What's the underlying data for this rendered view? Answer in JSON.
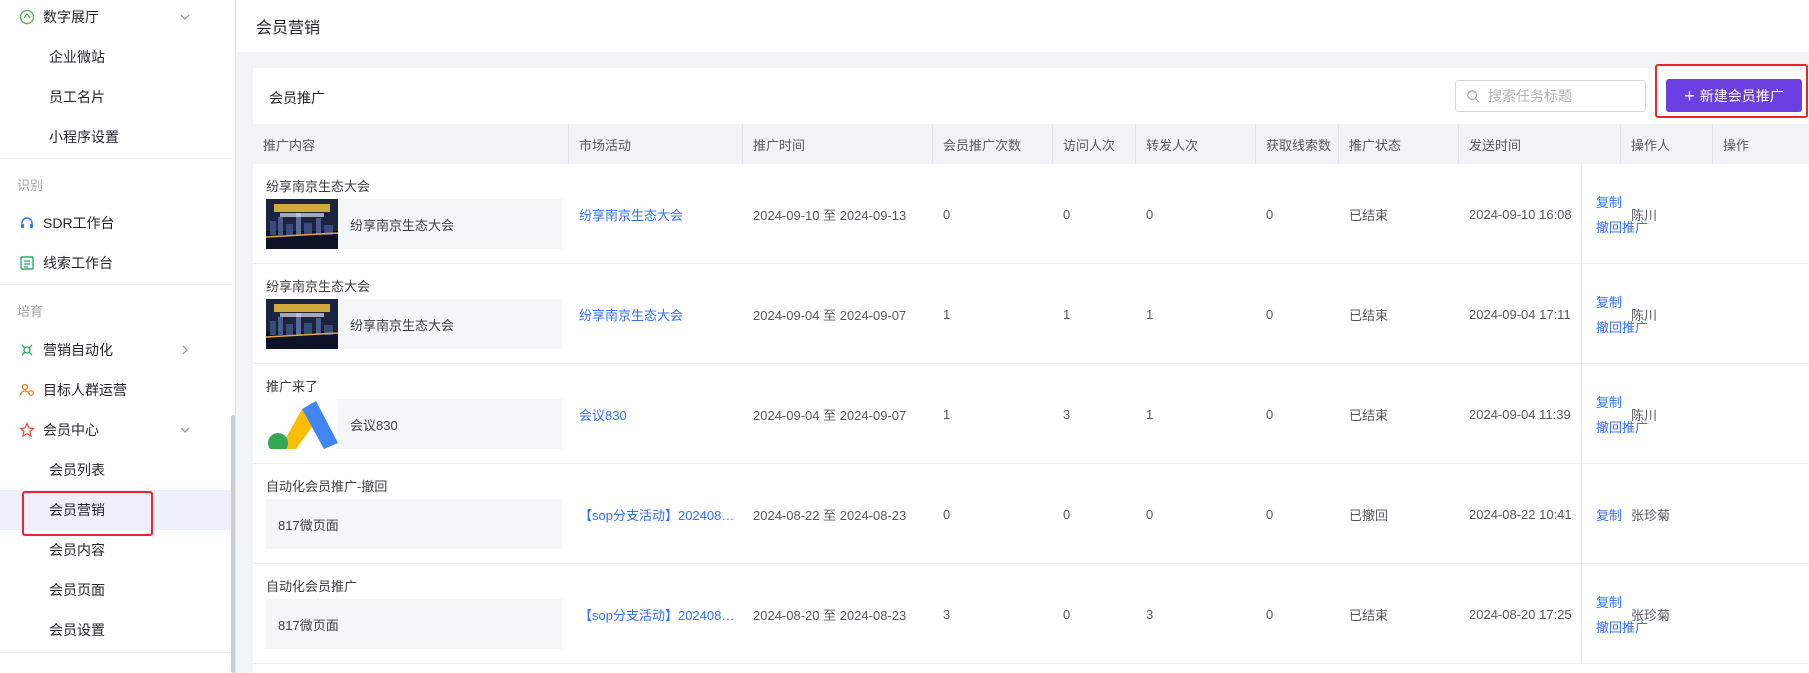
{
  "sidebar": {
    "digital_hall": "数字展厅",
    "items_a": [
      "企业微站",
      "员工名片",
      "小程序设置"
    ],
    "group_identify": "识别",
    "sdr": "SDR工作台",
    "leads": "线索工作台",
    "group_nurture": "培育",
    "marketing_auto": "营销自动化",
    "target_group": "目标人群运营",
    "member_center": "会员中心",
    "member_items": [
      "会员列表",
      "会员营销",
      "会员内容",
      "会员页面",
      "会员设置"
    ],
    "active_item": "会员营销"
  },
  "topbar": {
    "title": "会员营销"
  },
  "card": {
    "title": "会员推广",
    "search_placeholder": "搜索任务标题",
    "new_button": "新建会员推广"
  },
  "table": {
    "headers": [
      "推广内容",
      "市场活动",
      "推广时间",
      "会员推广次数",
      "访问人次",
      "转发人次",
      "获取线索数",
      "推广状态",
      "发送时间",
      "操作人",
      "操作"
    ],
    "rows": [
      {
        "title": "纷享南京生态大会",
        "thumb_text": "纷享南京生态大会",
        "thumb": "city",
        "activity": "纷享南京生态大会",
        "period": "2024-09-10 至 2024-09-13",
        "pushes": "0",
        "visits": "0",
        "shares": "0",
        "leads": "0",
        "status": "已结束",
        "sent": "2024-09-10 16:08",
        "operator": "陈川",
        "ops": [
          "复制",
          "撤回推广"
        ]
      },
      {
        "title": "纷享南京生态大会",
        "thumb_text": "纷享南京生态大会",
        "thumb": "city",
        "activity": "纷享南京生态大会",
        "period": "2024-09-04 至 2024-09-07",
        "pushes": "1",
        "visits": "1",
        "shares": "1",
        "leads": "0",
        "status": "已结束",
        "sent": "2024-09-04 17:11",
        "operator": "陈川",
        "ops": [
          "复制",
          "撤回推广"
        ]
      },
      {
        "title": "推广来了",
        "thumb_text": "会议830",
        "thumb": "logo",
        "activity": "会议830",
        "period": "2024-09-04 至 2024-09-07",
        "pushes": "1",
        "visits": "3",
        "shares": "1",
        "leads": "0",
        "status": "已结束",
        "sent": "2024-09-04 11:39",
        "operator": "陈川",
        "ops": [
          "复制",
          "撤回推广"
        ]
      },
      {
        "title": "自动化会员推广-撤回",
        "thumb_text": "817微页面",
        "thumb": "none",
        "activity": "【sop分支活动】2024082…",
        "period": "2024-08-22 至 2024-08-23",
        "pushes": "0",
        "visits": "0",
        "shares": "0",
        "leads": "0",
        "status": "已撤回",
        "sent": "2024-08-22 10:41",
        "operator": "张珍菊",
        "ops": [
          "复制"
        ]
      },
      {
        "title": "自动化会员推广",
        "thumb_text": "817微页面",
        "thumb": "none",
        "activity": "【sop分支活动】2024082…",
        "period": "2024-08-20 至 2024-08-23",
        "pushes": "3",
        "visits": "0",
        "shares": "3",
        "leads": "0",
        "status": "已结束",
        "sent": "2024-08-20 17:25",
        "operator": "张珍菊",
        "ops": [
          "复制",
          "撤回推广"
        ]
      }
    ]
  },
  "colors": {
    "accent": "#6b3fe0",
    "link": "#3370ff",
    "highlight": "#e8262b"
  }
}
